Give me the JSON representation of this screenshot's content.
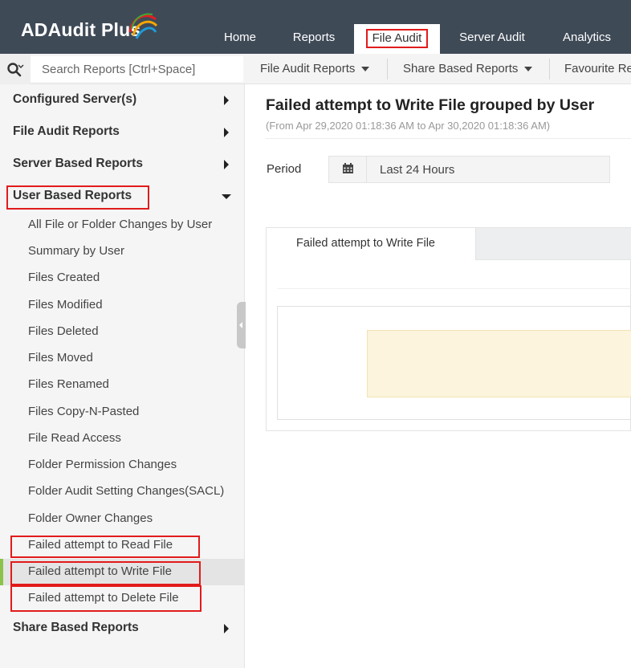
{
  "app": {
    "logo_text": "ADAudit Plus",
    "brand_colors": [
      "#e31e24",
      "#f7a600",
      "#1e9ad6",
      "#3aaa35"
    ]
  },
  "header": {
    "tabs": [
      {
        "label": "Home"
      },
      {
        "label": "Reports"
      },
      {
        "label": "File Audit",
        "active": true
      },
      {
        "label": "Server Audit"
      },
      {
        "label": "Analytics"
      }
    ]
  },
  "subheader": {
    "search_placeholder": "Search Reports [Ctrl+Space]",
    "menus": [
      {
        "label": "File Audit Reports"
      },
      {
        "label": "Share Based Reports"
      },
      {
        "label": "Favourite Re"
      }
    ]
  },
  "sidebar": {
    "sections": [
      {
        "label": "Configured Server(s)",
        "expanded": false
      },
      {
        "label": "File Audit Reports",
        "expanded": false
      },
      {
        "label": "Server Based Reports",
        "expanded": false
      },
      {
        "label": "User Based Reports",
        "expanded": true
      }
    ],
    "user_based_items": [
      {
        "label": "All File or Folder Changes by User"
      },
      {
        "label": "Summary by User"
      },
      {
        "label": "Files Created"
      },
      {
        "label": "Files Modified"
      },
      {
        "label": "Files Deleted"
      },
      {
        "label": "Files Moved"
      },
      {
        "label": "Files Renamed"
      },
      {
        "label": "Files Copy-N-Pasted"
      },
      {
        "label": "File Read Access"
      },
      {
        "label": "Folder Permission Changes"
      },
      {
        "label": "Folder Audit Setting Changes(SACL)"
      },
      {
        "label": "Folder Owner Changes"
      },
      {
        "label": "Failed attempt to Read File"
      },
      {
        "label": "Failed attempt to Write File",
        "selected": true
      },
      {
        "label": "Failed attempt to Delete File"
      }
    ],
    "bottom_section": {
      "label": "Share Based Reports",
      "expanded": false
    }
  },
  "main": {
    "title": "Failed attempt to Write File grouped by User",
    "subtitle": "(From Apr 29,2020 01:18:36 AM to Apr 30,2020 01:18:36 AM)",
    "period_label": "Period",
    "period_value": "Last 24 Hours",
    "period_icon": "calendar-icon",
    "tab_label": "Failed attempt to Write File"
  },
  "highlight_color": "#e21b1b",
  "selected_accent": "#8bc34a"
}
